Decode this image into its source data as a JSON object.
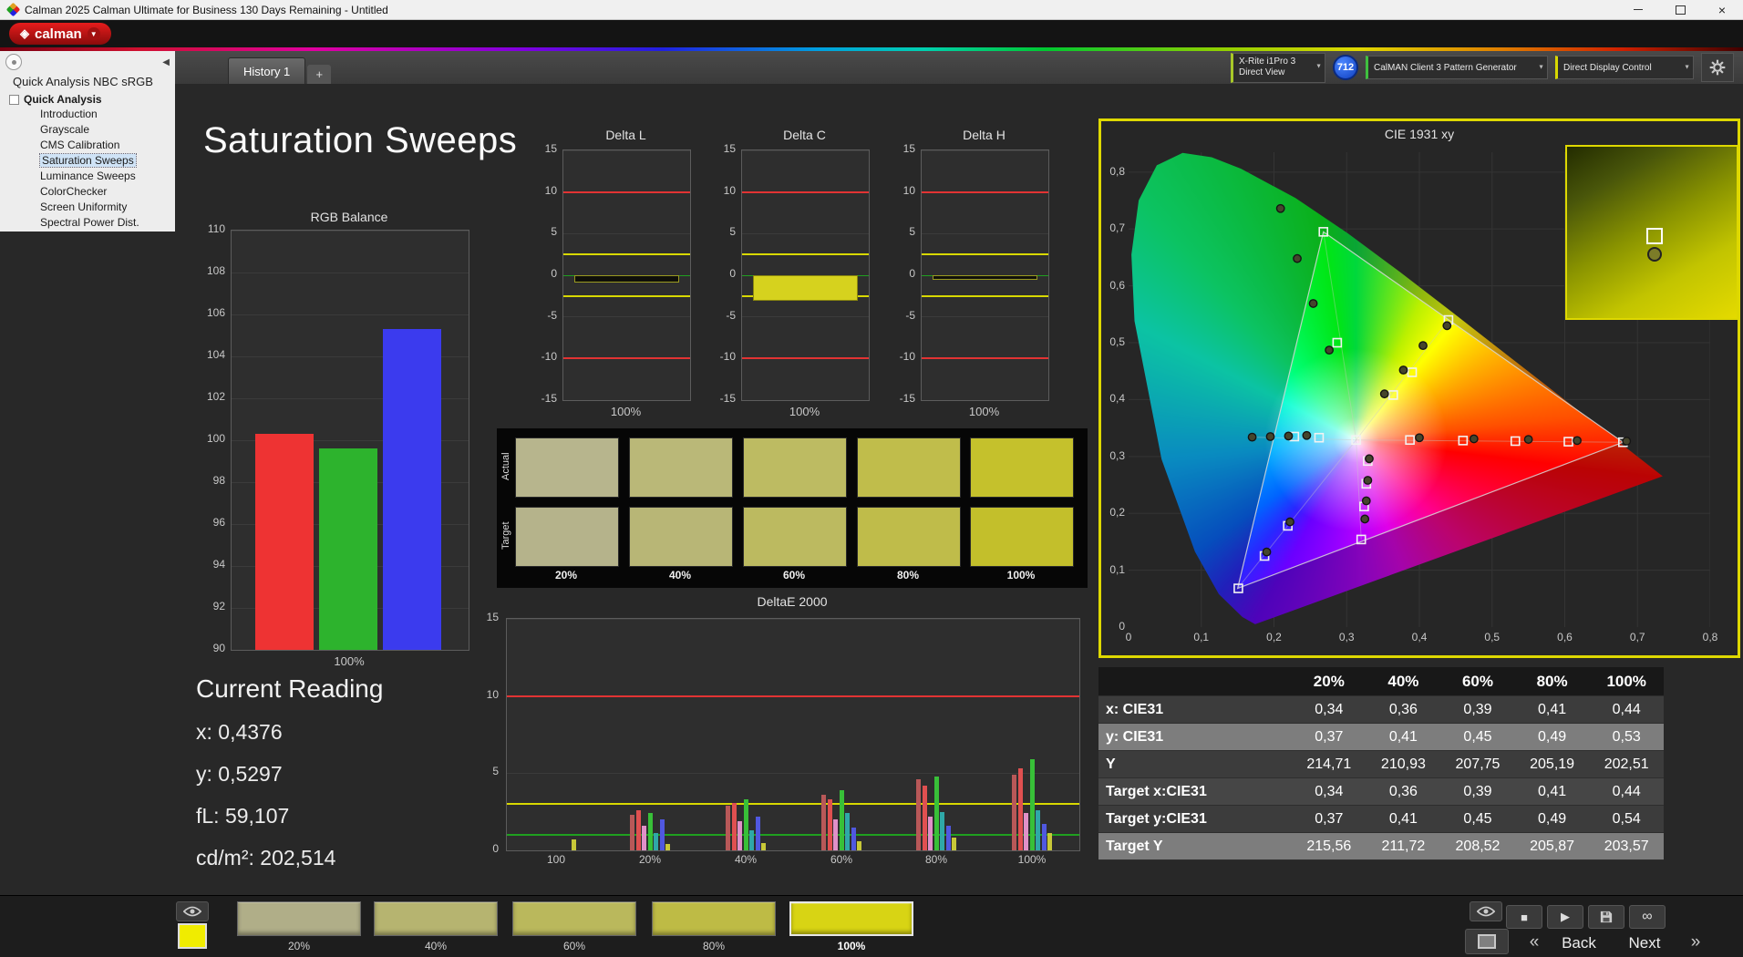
{
  "window": {
    "title": "Calman 2025 Calman Ultimate for Business 130 Days Remaining  - Untitled",
    "close_glyph": "×"
  },
  "logo": {
    "brand": "calman"
  },
  "tabs": {
    "history_tab": "History 1",
    "add_tab": "+"
  },
  "devices": {
    "meter_line1": "X-Rite i1Pro 3",
    "meter_line2": "Direct View",
    "meter_badge": "712",
    "pattern_generator": "CalMAN Client 3 Pattern Generator",
    "display_control": "Direct Display Control",
    "accents": {
      "meter": "#a8c828",
      "pattern_generator": "#3fbf3f",
      "display_control": "#d8d800"
    }
  },
  "sidebar": {
    "title": "Quick Analysis NBC sRGB",
    "root": "Quick Analysis",
    "items": [
      "Introduction",
      "Grayscale",
      "CMS Calibration",
      "Saturation Sweeps",
      "Luminance Sweeps",
      "ColorChecker",
      "Screen Uniformity",
      "Spectral Power Dist."
    ],
    "selected_index": 3
  },
  "page": {
    "title": "Saturation Sweeps"
  },
  "current_reading": {
    "title": "Current Reading",
    "lines": [
      "x: 0,4376",
      "y: 0,5297",
      "fL: 59,107",
      "cd/m²: 202,514"
    ]
  },
  "swatches": {
    "row_labels": [
      "Actual",
      "Target"
    ],
    "col_labels": [
      "20%",
      "40%",
      "60%",
      "80%",
      "100%"
    ],
    "actual": [
      "#b7b58d",
      "#bab878",
      "#bdbb62",
      "#c0bd4b",
      "#c5c12c"
    ],
    "target": [
      "#b5b38b",
      "#b8b676",
      "#bcba60",
      "#bfbc4a",
      "#c3bf2b"
    ]
  },
  "table": {
    "headers": [
      "",
      "20%",
      "40%",
      "60%",
      "80%",
      "100%"
    ],
    "rows": [
      {
        "label": "x: CIE31",
        "values": [
          "0,34",
          "0,36",
          "0,39",
          "0,41",
          "0,44"
        ]
      },
      {
        "label": "y: CIE31",
        "values": [
          "0,37",
          "0,41",
          "0,45",
          "0,49",
          "0,53"
        ]
      },
      {
        "label": "Y",
        "values": [
          "214,71",
          "210,93",
          "207,75",
          "205,19",
          "202,51"
        ]
      },
      {
        "label": "Target x:CIE31",
        "values": [
          "0,34",
          "0,36",
          "0,39",
          "0,41",
          "0,44"
        ]
      },
      {
        "label": "Target y:CIE31",
        "values": [
          "0,37",
          "0,41",
          "0,45",
          "0,49",
          "0,54"
        ]
      },
      {
        "label": "Target Y",
        "values": [
          "215,56",
          "211,72",
          "208,52",
          "205,87",
          "203,57"
        ]
      }
    ]
  },
  "bottom": {
    "mini_swatch_color": "#f0ec00",
    "levels": [
      {
        "label": "20%",
        "color": "#b0ae88",
        "selected": false
      },
      {
        "label": "40%",
        "color": "#b6b470",
        "selected": false
      },
      {
        "label": "60%",
        "color": "#bab85c",
        "selected": false
      },
      {
        "label": "80%",
        "color": "#bebb45",
        "selected": false
      },
      {
        "label": "100%",
        "color": "#d8d414",
        "selected": true
      }
    ],
    "back_label": "Back",
    "next_label": "Next",
    "icons": {
      "stop": "■",
      "play": "▶",
      "infinity": "∞",
      "chevrons_left": "«",
      "chevrons_right": "»",
      "collapse": "◀"
    }
  },
  "chart_data": [
    {
      "id": "rgb_balance",
      "type": "bar",
      "title": "RGB Balance",
      "xlabel": "100%",
      "ylim": [
        90,
        110
      ],
      "yticks": [
        110,
        108,
        106,
        104,
        102,
        100,
        98,
        96,
        94,
        92,
        90
      ],
      "series": [
        {
          "name": "Red",
          "color": "#ee3333",
          "value": 100.3
        },
        {
          "name": "Green",
          "color": "#2db32d",
          "value": 99.6
        },
        {
          "name": "Blue",
          "color": "#3b3bee",
          "value": 105.3
        }
      ]
    },
    {
      "id": "delta_l",
      "type": "bar",
      "title": "Delta L",
      "xlabel": "100%",
      "ylim": [
        -15,
        15
      ],
      "yticks": [
        15,
        10,
        5,
        0,
        -5,
        -10,
        -15
      ],
      "value": -0.9,
      "bar_color": "#10100a",
      "bar_border": "#9a9a20",
      "ref_lines": [
        {
          "value": 10,
          "color": "#e23333"
        },
        {
          "value": -10,
          "color": "#e23333"
        },
        {
          "value": 2.5,
          "color": "#d8d800"
        },
        {
          "value": -2.5,
          "color": "#d8d800"
        },
        {
          "value": 0,
          "color": "#1fa01f"
        }
      ]
    },
    {
      "id": "delta_c",
      "type": "bar",
      "title": "Delta C",
      "xlabel": "100%",
      "ylim": [
        -15,
        15
      ],
      "yticks": [
        15,
        10,
        5,
        0,
        -5,
        -10,
        -15
      ],
      "value": -3.1,
      "bar_color": "#d6d21e",
      "bar_border": "#8a860e",
      "ref_lines": [
        {
          "value": 10,
          "color": "#e23333"
        },
        {
          "value": -10,
          "color": "#e23333"
        },
        {
          "value": 2.5,
          "color": "#d8d800"
        },
        {
          "value": -2.5,
          "color": "#d8d800"
        },
        {
          "value": 0,
          "color": "#1fa01f"
        }
      ]
    },
    {
      "id": "delta_h",
      "type": "bar",
      "title": "Delta H",
      "xlabel": "100%",
      "ylim": [
        -15,
        15
      ],
      "yticks": [
        15,
        10,
        5,
        0,
        -5,
        -10,
        -15
      ],
      "value": -0.6,
      "bar_color": "#10100a",
      "bar_border": "#9a9a20",
      "ref_lines": [
        {
          "value": 10,
          "color": "#e23333"
        },
        {
          "value": -10,
          "color": "#e23333"
        },
        {
          "value": 2.5,
          "color": "#d8d800"
        },
        {
          "value": -2.5,
          "color": "#d8d800"
        },
        {
          "value": 0,
          "color": "#1fa01f"
        }
      ]
    },
    {
      "id": "deltae",
      "type": "grouped-bar",
      "title": "DeltaE 2000",
      "ylim": [
        0,
        15
      ],
      "yticks": [
        15,
        10,
        5,
        0
      ],
      "categories": [
        "100",
        "20%",
        "40%",
        "60%",
        "80%",
        "100%"
      ],
      "series_colors": [
        "#b85858",
        "#e05050",
        "#e090c8",
        "#38c038",
        "#2fa8a8",
        "#5058e0",
        "#c8c838"
      ],
      "groups": [
        [
          0,
          0,
          0,
          0,
          0,
          0,
          0.7
        ],
        [
          2.3,
          2.6,
          1.6,
          2.4,
          1.1,
          2.0,
          0.4
        ],
        [
          2.9,
          3.1,
          1.9,
          3.3,
          1.3,
          2.2,
          0.5
        ],
        [
          3.6,
          3.3,
          2.0,
          3.9,
          2.4,
          1.5,
          0.6
        ],
        [
          4.6,
          4.2,
          2.2,
          4.8,
          2.5,
          1.6,
          0.8
        ],
        [
          4.9,
          5.3,
          2.4,
          5.9,
          2.6,
          1.7,
          1.1
        ]
      ],
      "ref_lines": [
        {
          "value": 10,
          "color": "#e23333"
        },
        {
          "value": 3,
          "color": "#d8d800"
        },
        {
          "value": 1,
          "color": "#1fa01f"
        }
      ]
    },
    {
      "id": "cie",
      "type": "scatter",
      "title": "CIE 1931 xy",
      "xlim": [
        0,
        0.8
      ],
      "ylim": [
        0,
        0.8
      ],
      "xtick_labels": [
        "0",
        "0,1",
        "0,2",
        "0,3",
        "0,4",
        "0,5",
        "0,6",
        "0,7",
        "0,8"
      ],
      "ytick_labels": [
        "0,8",
        "0,7",
        "0,6",
        "0,5",
        "0,4",
        "0,3",
        "0,2",
        "0,1",
        "0"
      ],
      "white_point": [
        0.313,
        0.329
      ],
      "gamut_triangle": [
        [
          0.68,
          0.325
        ],
        [
          0.268,
          0.695
        ],
        [
          0.15,
          0.068
        ]
      ],
      "sweep_line_targets": [
        [
          0.68,
          0.325
        ],
        [
          0.44,
          0.54
        ],
        [
          0.32,
          0.154
        ],
        [
          0.17,
          0.334
        ],
        [
          0.268,
          0.695
        ],
        [
          0.15,
          0.068
        ]
      ],
      "target_squares": [
        [
          0.313,
          0.329
        ],
        [
          0.387,
          0.329
        ],
        [
          0.46,
          0.328
        ],
        [
          0.532,
          0.327
        ],
        [
          0.605,
          0.326
        ],
        [
          0.68,
          0.325
        ],
        [
          0.364,
          0.408
        ],
        [
          0.39,
          0.448
        ],
        [
          0.44,
          0.54
        ],
        [
          0.329,
          0.292
        ],
        [
          0.327,
          0.252
        ],
        [
          0.324,
          0.212
        ],
        [
          0.32,
          0.154
        ],
        [
          0.219,
          0.178
        ],
        [
          0.187,
          0.125
        ],
        [
          0.151,
          0.068
        ],
        [
          0.287,
          0.5
        ],
        [
          0.268,
          0.695
        ],
        [
          0.262,
          0.333
        ],
        [
          0.228,
          0.335
        ]
      ],
      "measured_circles": [
        [
          0.4,
          0.333
        ],
        [
          0.475,
          0.331
        ],
        [
          0.55,
          0.33
        ],
        [
          0.617,
          0.328
        ],
        [
          0.685,
          0.327
        ],
        [
          0.352,
          0.41
        ],
        [
          0.378,
          0.452
        ],
        [
          0.405,
          0.495
        ],
        [
          0.438,
          0.53
        ],
        [
          0.331,
          0.296
        ],
        [
          0.329,
          0.258
        ],
        [
          0.327,
          0.222
        ],
        [
          0.325,
          0.19
        ],
        [
          0.17,
          0.334
        ],
        [
          0.195,
          0.335
        ],
        [
          0.22,
          0.336
        ],
        [
          0.245,
          0.337
        ],
        [
          0.209,
          0.736
        ],
        [
          0.232,
          0.648
        ],
        [
          0.254,
          0.569
        ],
        [
          0.276,
          0.487
        ],
        [
          0.222,
          0.185
        ],
        [
          0.19,
          0.132
        ]
      ]
    }
  ]
}
